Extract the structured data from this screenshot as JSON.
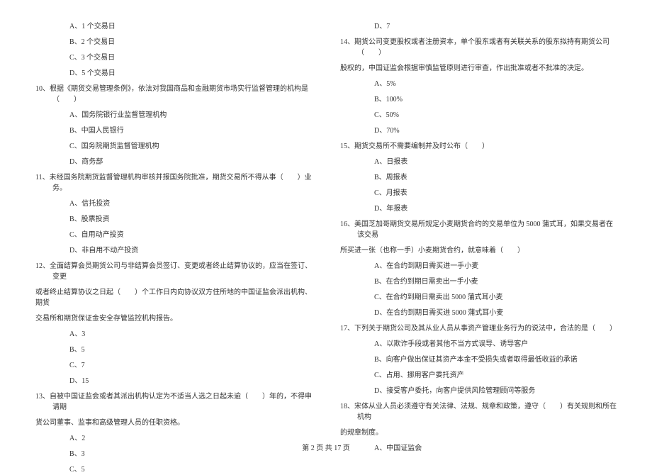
{
  "left_column": [
    {
      "type": "option",
      "text": "A、1 个交易日"
    },
    {
      "type": "option",
      "text": "B、2 个交易日"
    },
    {
      "type": "option",
      "text": "C、3 个交易日"
    },
    {
      "type": "option",
      "text": "D、5 个交易日"
    },
    {
      "type": "question-first",
      "text": "10、根据《期货交易管理条例》，依法对我国商品和金融期货市场实行监督管理的机构是（　　）"
    },
    {
      "type": "option",
      "text": "A、国务院银行业监督管理机构"
    },
    {
      "type": "option",
      "text": "B、中国人民银行"
    },
    {
      "type": "option",
      "text": "C、国务院期货监督管理机构"
    },
    {
      "type": "option",
      "text": "D、商务部"
    },
    {
      "type": "question-first",
      "text": "11、未经国务院期货监督管理机构审核并报国务院批准，期货交易所不得从事（　　）业务。"
    },
    {
      "type": "option",
      "text": "A、信托投资"
    },
    {
      "type": "option",
      "text": "B、股票投资"
    },
    {
      "type": "option",
      "text": "C、自用动产投资"
    },
    {
      "type": "option",
      "text": "D、非自用不动产投资"
    },
    {
      "type": "question-first",
      "text": "12、全面结算会员期货公司与非结算会员签订、变更或者终止结算协议的，应当在签订、变更"
    },
    {
      "type": "question-cont",
      "text": "或者终止结算协议之日起（　　）个工作日内向协议双方住所地的中国证监会派出机构、期货"
    },
    {
      "type": "question-cont",
      "text": "交易所和期货保证金安全存管监控机构报告。"
    },
    {
      "type": "option",
      "text": "A、3"
    },
    {
      "type": "option",
      "text": "B、5"
    },
    {
      "type": "option",
      "text": "C、7"
    },
    {
      "type": "option",
      "text": "D、15"
    },
    {
      "type": "question-first",
      "text": "13、自被中国证监会或者其派出机构认定为不适当人选之日起未逾（　　）年的，不得申请期"
    },
    {
      "type": "question-cont",
      "text": "货公司董事、监事和高级管理人员的任职资格。"
    },
    {
      "type": "option",
      "text": "A、2"
    },
    {
      "type": "option",
      "text": "B、3"
    },
    {
      "type": "option",
      "text": "C、5"
    }
  ],
  "right_column": [
    {
      "type": "option",
      "text": "D、7"
    },
    {
      "type": "question-first",
      "text": "14、期货公司变更股权或者注册资本，单个股东或者有关联关系的股东拟持有期货公司（　　）"
    },
    {
      "type": "question-cont",
      "text": "股权的，中国证监会根据审慎监管原则进行审查，作出批准或者不批准的决定。"
    },
    {
      "type": "option",
      "text": "A、5%"
    },
    {
      "type": "option",
      "text": "B、100%"
    },
    {
      "type": "option",
      "text": "C、50%"
    },
    {
      "type": "option",
      "text": "D、70%"
    },
    {
      "type": "question-first",
      "text": "15、期货交易所不需要编制并及时公布（　　）"
    },
    {
      "type": "option",
      "text": "A、日报表"
    },
    {
      "type": "option",
      "text": "B、周报表"
    },
    {
      "type": "option",
      "text": "C、月报表"
    },
    {
      "type": "option",
      "text": "D、年报表"
    },
    {
      "type": "question-first",
      "text": "16、美国芝加哥期货交易所规定小麦期货合约的交易单位为 5000 蒲式耳，如果交易者在该交易"
    },
    {
      "type": "question-cont",
      "text": "所买进一张（也称一手）小麦期货合约，就意味着（　　）"
    },
    {
      "type": "option",
      "text": "A、在合约到期日需买进一手小麦"
    },
    {
      "type": "option",
      "text": "B、在合约到期日需卖出一手小麦"
    },
    {
      "type": "option",
      "text": "C、在合约到期日需卖出 5000 蒲式耳小麦"
    },
    {
      "type": "option",
      "text": "D、在合约到期日需买进 5000 蒲式耳小麦"
    },
    {
      "type": "question-first",
      "text": "17、下列关于期货公司及其从业人员从事资产管理业务行为的说法中，合法的是（　　）"
    },
    {
      "type": "option",
      "text": "A、以欺诈手段或者其他不当方式误导、诱导客户"
    },
    {
      "type": "option",
      "text": "B、向客户做出保证其资产本金不受损失或者取得最低收益的承诺"
    },
    {
      "type": "option",
      "text": "C、占用、挪用客户委托资产"
    },
    {
      "type": "option",
      "text": "D、接受客户委托，向客户提供风险管理顾问等服务"
    },
    {
      "type": "question-first",
      "text": "18、宋体从业人员必须遵守有关法律、法规、规章和政策，遵守（　　）有关规则和所在机构"
    },
    {
      "type": "question-cont",
      "text": "的规章制度。"
    },
    {
      "type": "option",
      "text": "A、中国证监会"
    }
  ],
  "footer": "第 2 页 共 17 页"
}
